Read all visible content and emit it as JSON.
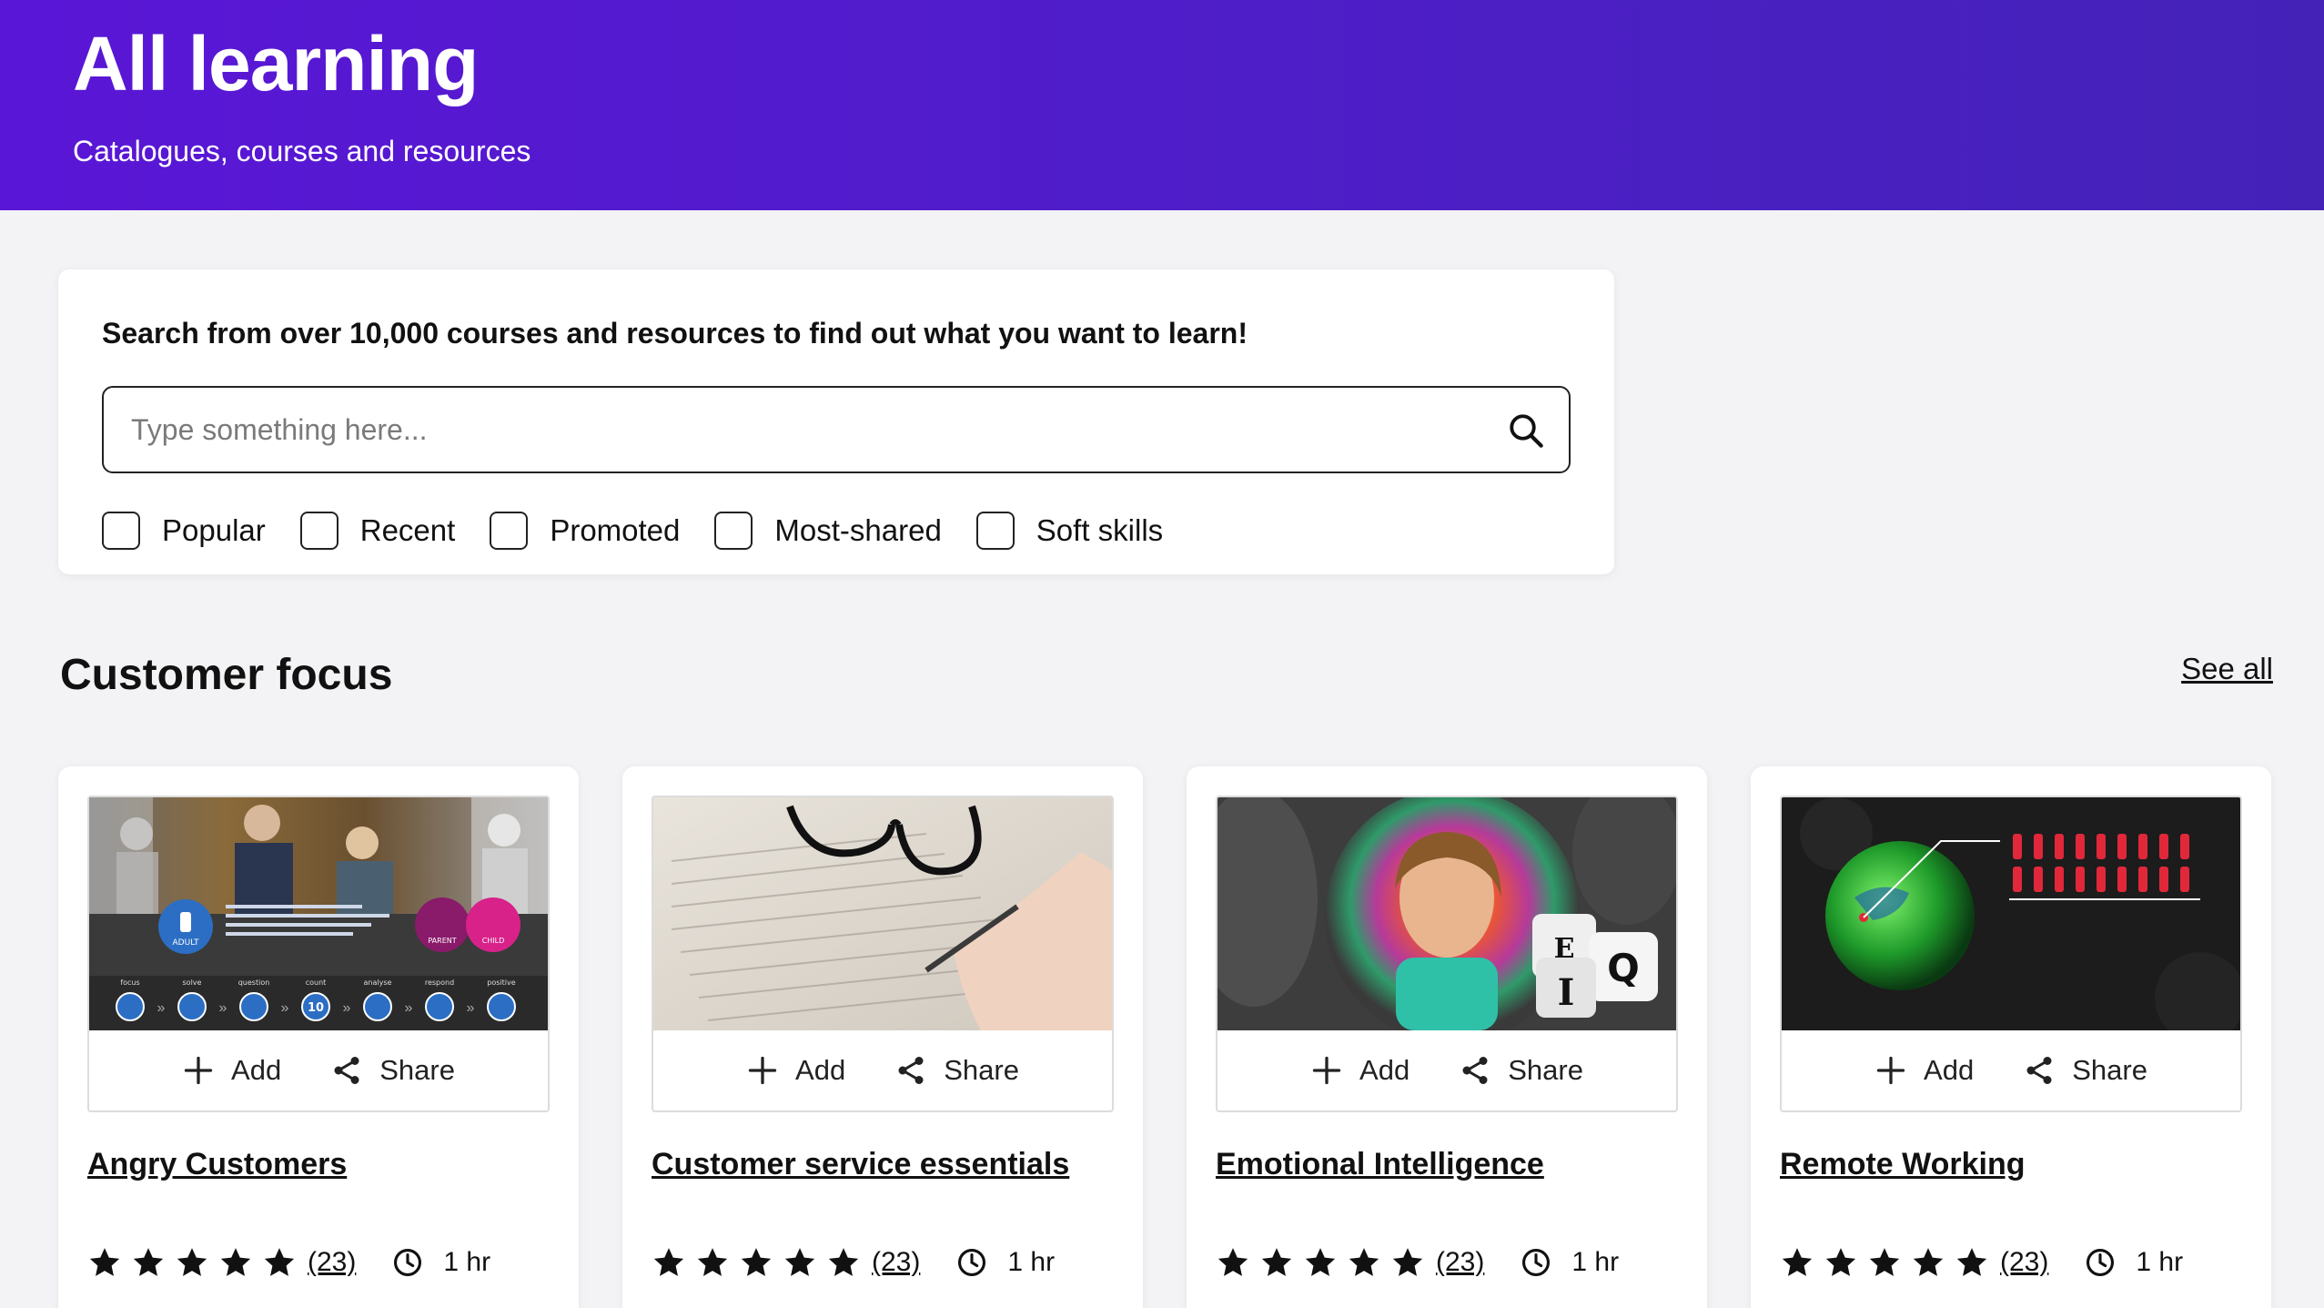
{
  "header": {
    "title": "All learning",
    "subtitle": "Catalogues, courses and resources"
  },
  "search": {
    "heading": "Search from over 10,000 courses and resources to find out what you want to learn!",
    "placeholder": "Type something here...",
    "value": "",
    "icon": "search-icon",
    "filters": [
      {
        "label": "Popular",
        "checked": false
      },
      {
        "label": "Recent",
        "checked": false
      },
      {
        "label": "Promoted",
        "checked": false
      },
      {
        "label": "Most-shared",
        "checked": false
      },
      {
        "label": "Soft skills",
        "checked": false
      }
    ]
  },
  "section": {
    "title": "Customer focus",
    "see_all": "See all"
  },
  "thumbnail_text": {
    "adult": "ADULT",
    "parent": "PARENT",
    "child": "CHILD",
    "eq_letters": [
      "E",
      "I",
      "Q"
    ],
    "steps": [
      "focus",
      "solve",
      "question",
      "count",
      "analyse",
      "respond",
      "positive"
    ],
    "count_value": "10"
  },
  "cards": [
    {
      "title": "Angry Customers",
      "add_label": "Add",
      "share_label": "Share",
      "rating": 5,
      "rating_count": "(23)",
      "duration": "1 hr"
    },
    {
      "title": "Customer service essentials",
      "add_label": "Add",
      "share_label": "Share",
      "rating": 5,
      "rating_count": "(23)",
      "duration": "1 hr"
    },
    {
      "title": "Emotional Intelligence",
      "add_label": "Add",
      "share_label": "Share",
      "rating": 5,
      "rating_count": "(23)",
      "duration": "1 hr"
    },
    {
      "title": "Remote Working",
      "add_label": "Add",
      "share_label": "Share",
      "rating": 5,
      "rating_count": "(23)",
      "duration": "1 hr"
    }
  ],
  "colors": {
    "brand_gradient_start": "#5a16d6",
    "brand_gradient_end": "#4422b8",
    "page_background": "#f3f3f6",
    "text": "#111111"
  }
}
